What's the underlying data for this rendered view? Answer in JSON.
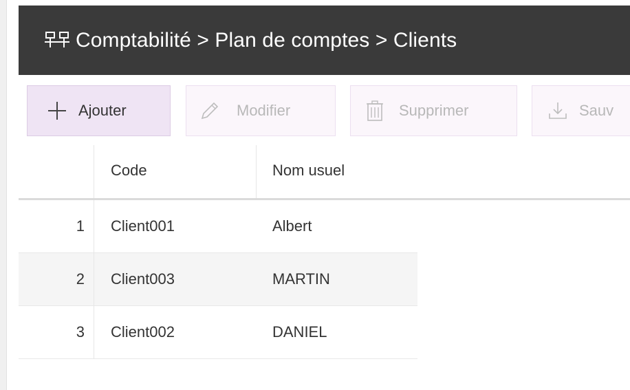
{
  "header": {
    "icon": "hierarchy-icon",
    "title": "Comptabilité > Plan de comptes > Clients"
  },
  "toolbar": {
    "add": {
      "label": "Ajouter",
      "icon": "plus-icon"
    },
    "edit": {
      "label": "Modifier",
      "icon": "pencil-icon"
    },
    "delete": {
      "label": "Supprimer",
      "icon": "trash-icon"
    },
    "save": {
      "label": "Sauv",
      "icon": "download-icon"
    }
  },
  "table": {
    "columns": [
      "",
      "Code",
      "Nom usuel"
    ],
    "rows": [
      {
        "num": "1",
        "code": "Client001",
        "nom": "Albert"
      },
      {
        "num": "2",
        "code": "Client003",
        "nom": "MARTIN"
      },
      {
        "num": "3",
        "code": "Client002",
        "nom": "DANIEL"
      }
    ]
  },
  "colors": {
    "titlebar": "#3a3a3a",
    "primary_button": "#efe4f4",
    "alt_row": "#f5f5f5"
  }
}
